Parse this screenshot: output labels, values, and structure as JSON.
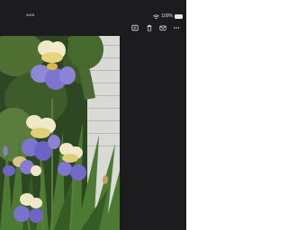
{
  "status_bar": {
    "more_dots": "•••",
    "battery_percent": "100%",
    "icons": [
      "wifi-icon",
      "battery-icon"
    ]
  },
  "toolbar": {
    "icons": [
      "crop-icon",
      "trash-icon",
      "mail-icon",
      "more-icon"
    ]
  },
  "photo": {
    "subject": "flowers-photo"
  },
  "colors": {
    "background": "#1c1c1e",
    "page": "#ffffff",
    "icon": "#e5e5ea"
  }
}
